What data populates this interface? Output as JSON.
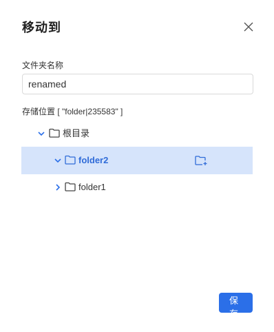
{
  "dialog": {
    "title": "移动到",
    "name_label": "文件夹名称",
    "name_value": "renamed",
    "location_label": "存储位置 [ \"folder|235583\" ]",
    "save_label": "保 存"
  },
  "tree": {
    "root": {
      "label": "根目录",
      "expanded": true
    },
    "items": [
      {
        "label": "folder2",
        "expanded": true,
        "selected": true
      },
      {
        "label": "folder1",
        "expanded": false,
        "selected": false
      }
    ]
  },
  "colors": {
    "accent": "#2b6fe8",
    "selected_bg": "#d6e4fb",
    "selected_text": "#2f6bd8"
  },
  "icons": {
    "close": "close-icon",
    "folder": "folder-icon",
    "expand": "chevron-down-icon",
    "collapse": "chevron-right-icon",
    "new_folder": "new-folder-icon"
  }
}
